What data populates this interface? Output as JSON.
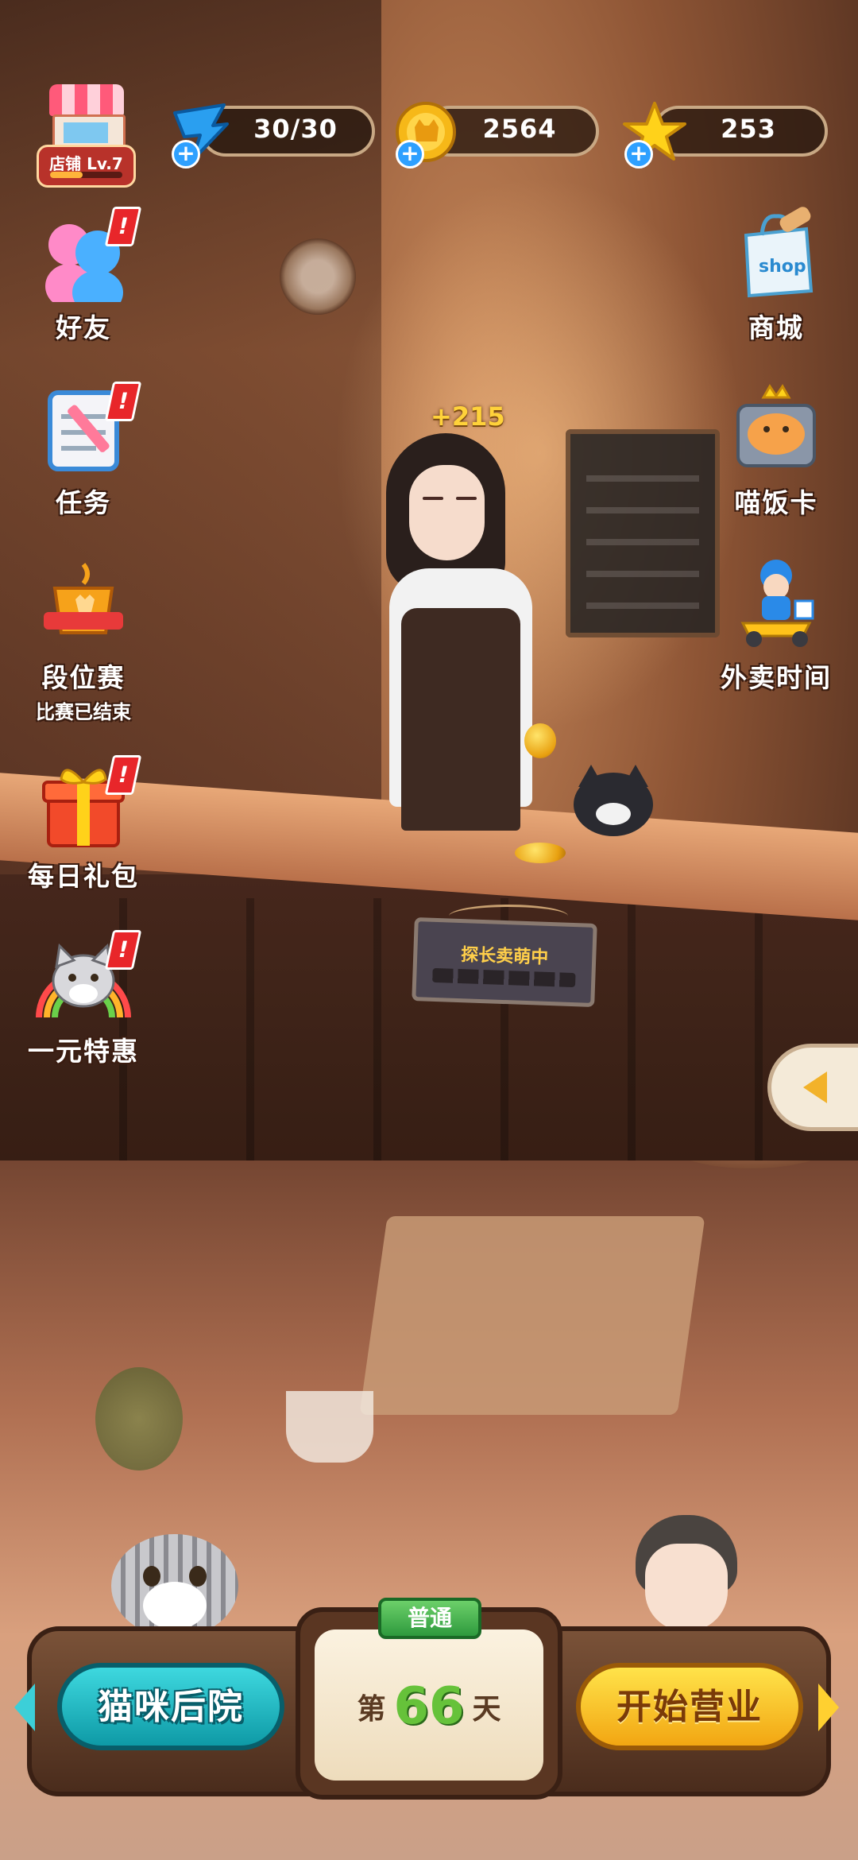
{
  "hud": {
    "shop_level_label": "店铺 Lv.7",
    "shop_level_progress": 0.45,
    "stamina": "30/30",
    "coins": "2564",
    "stars": "253"
  },
  "left_menu": {
    "friends": "好友",
    "tasks": "任务",
    "rank_match": "段位赛",
    "rank_match_status": "比赛已结束",
    "daily_gift": "每日礼包",
    "one_yuan_deal": "一元特惠"
  },
  "right_menu": {
    "store": "商城",
    "cat_food_card": "喵饭卡",
    "delivery_time": "外卖时间"
  },
  "badge_mark": "!",
  "scene": {
    "earned_bonus": "+215",
    "counter_sign": "探长卖萌中"
  },
  "bottom": {
    "backyard_button": "猫咪后院",
    "mode_tag": "普通",
    "day_prefix": "第",
    "day_number": "66",
    "day_suffix": "天",
    "start_button": "开始营业"
  },
  "colors": {
    "coin_gold": "#f2b22a",
    "backyard_teal": "#14a8b4",
    "start_yellow": "#f7c21e",
    "badge_red": "#e8262a",
    "mode_green": "#3aaa48"
  }
}
